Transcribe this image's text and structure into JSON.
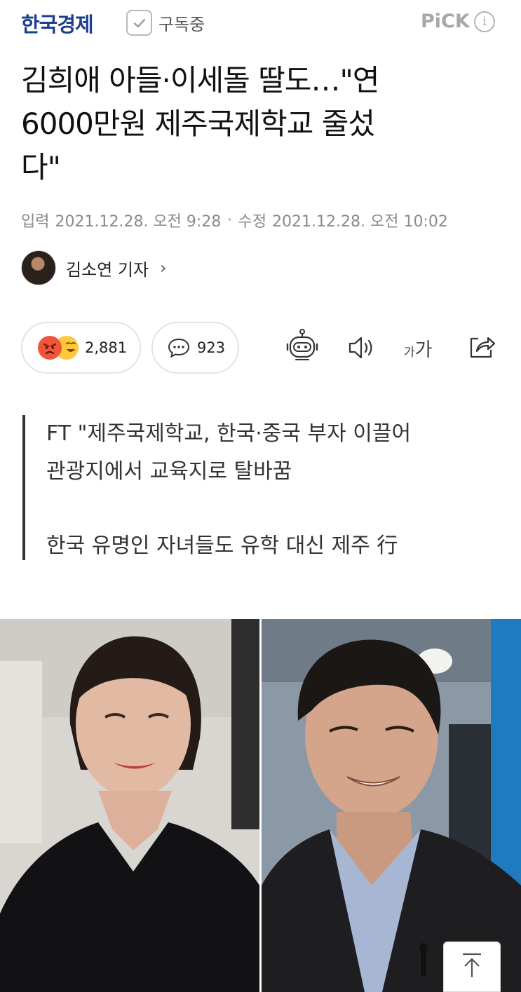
{
  "header": {
    "press": "한국경제",
    "subscribe_label": "구독중",
    "pick_label": "PiCK",
    "info_glyph": "i"
  },
  "article": {
    "headline_lines": [
      "김희애 아들·이세돌 딸도…\"연",
      "6000만원 제주국제학교 줄섰",
      "다\""
    ],
    "input_label": "입력",
    "input_time": "2021.12.28. 오전 9:28",
    "modified_label": "수정",
    "modified_time": "2021.12.28. 오전 10:02",
    "reporter": "김소연 기자",
    "reporter_chevron": "›"
  },
  "actions": {
    "reaction_count": "2,881",
    "comment_count": "923",
    "font_small": "가",
    "font_big": "가",
    "icons": [
      "angry-emoji",
      "smile-emoji",
      "comment-icon",
      "robot-summary-icon",
      "speaker-icon",
      "share-icon"
    ]
  },
  "summary": {
    "line1": "FT \"제주국제학교, 한국·중국 부자 이끌어",
    "line2": "관광지에서 교육지로 탈바꿈",
    "line3": "한국 유명인 자녀들도 유학 대신 제주 行"
  },
  "colors": {
    "press_blue": "#1e3f8f",
    "angry": "#f0543a",
    "smile": "#ffc83b",
    "muted_text": "#8a8a8a"
  }
}
